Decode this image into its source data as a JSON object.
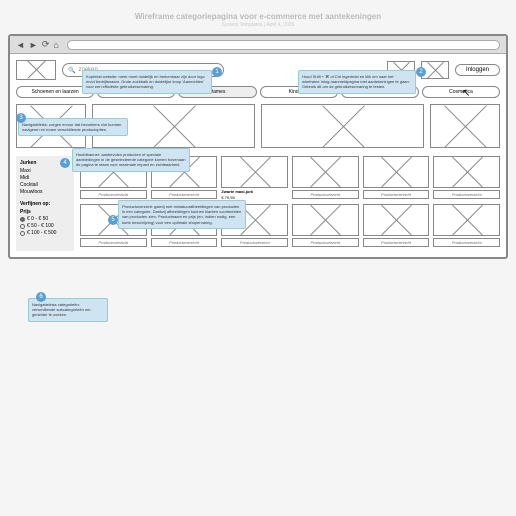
{
  "title": "Wireframe categoriepagina voor e-commerce met aantekeningen",
  "subtitle": "System Templates | April 4, 2025",
  "search_placeholder": "zoeken",
  "login": "Inloggen",
  "tabs": [
    "Schoenen en laarzen",
    "Heren",
    "Dames",
    "Kinderen",
    "Beddengoed",
    "Cosmetica"
  ],
  "sidebar": {
    "heading": "Jurken",
    "items": [
      "Maxi",
      "Midi",
      "Cocktail",
      "Mouwloos"
    ],
    "refine_title": "Verfijnen op:",
    "price_label": "Prijs",
    "opts": [
      "€ 0 - € 50",
      "€ 50 - € 100",
      "€ 100 - € 500"
    ]
  },
  "featured": {
    "name": "Zwarte maxi-jurk",
    "price": "€ 79,95"
  },
  "prod_label": "Productoverzicht",
  "annotations": {
    "a1": "Koptekst website: merk moet duidelijk en herkenbaar zijn door logo en/of bedrijfsnaam. Grote zoekbalk en duidelijke knop 'Aanmelden' voor een efficiënte gebruikerservaring.",
    "a2": "Houd Shift + ⌘ of Ctrl ingedrukt en klik om naar het wireframe Inlog-/aanmeldpagina met aantekeningen te gaan. Gebruik dit om de gebruikerservaring te testen.",
    "a3": "Navigatielinks: zorgen ervoor dat bezoekers vlot kunnen navigeren en tonen verschillende productopties.",
    "a4": "Hoofdbanner: aanbevolen producten of speciale aanbiedingen in de geselecteerde categorie komen bovenaan de pagina te staan voor maximale impact en zichtbaarheid.",
    "a5": "Productoverzicht: galerij met miniatuurafbeeldingen van producten in een categorie. Dankzij afbeeldingen kunnen klanten voorbeelden van producten zien. Productnaam en prijs (en, indien nodig, een korte beschrijving) voor een optimale shopervaring.",
    "a6": "Navigatielinks categorieën: verschillende subcategorieën om gerichter te zoeken."
  },
  "badges": {
    "b1": "1",
    "b2": "2",
    "b3": "3",
    "b4": "4",
    "b5": "5",
    "b6": "6"
  }
}
